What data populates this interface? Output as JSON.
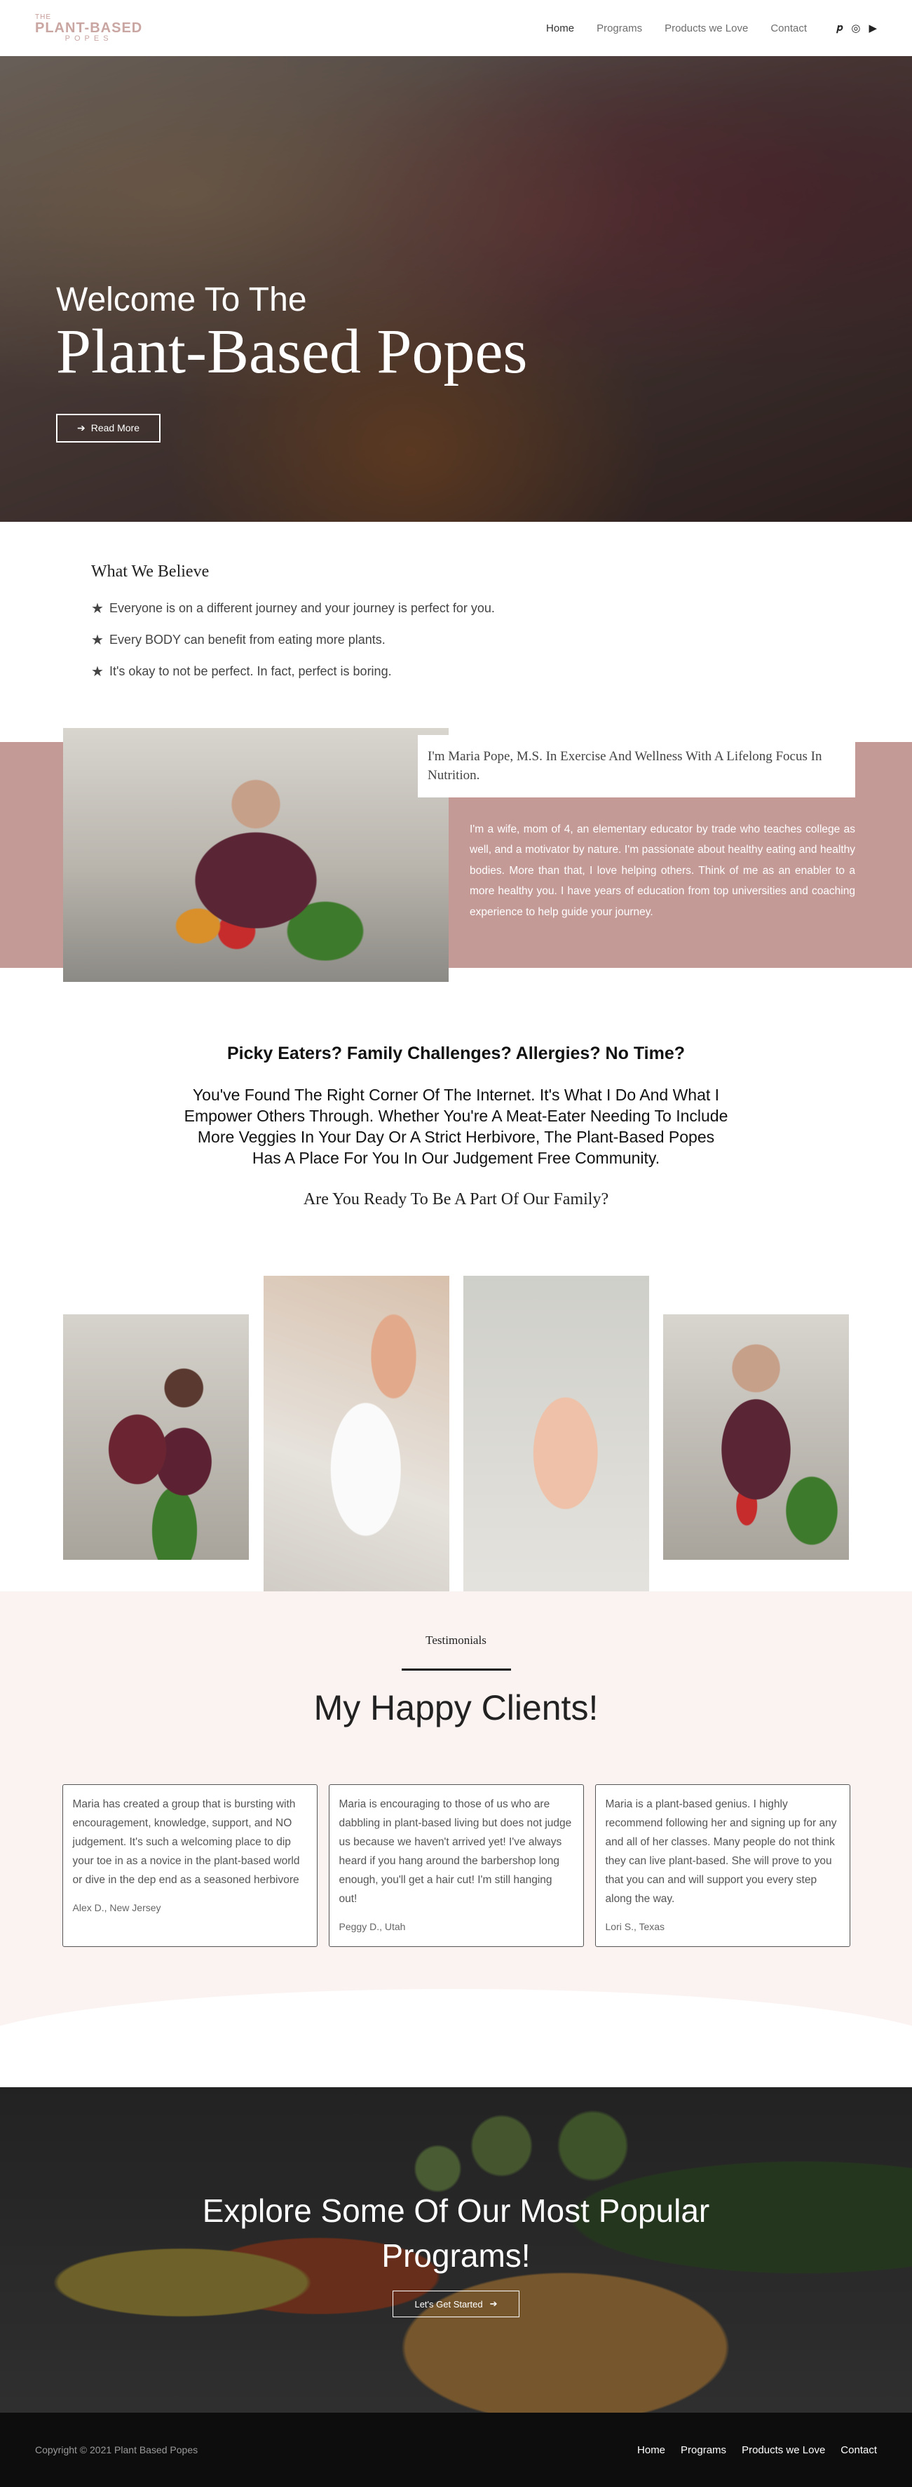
{
  "header": {
    "logo": {
      "the": "THE",
      "main": "PLANT-BASED",
      "sub": "POPES"
    },
    "nav": [
      "Home",
      "Programs",
      "Products we Love",
      "Contact"
    ],
    "social": [
      {
        "icon": "pinterest-icon",
        "glyph": "𝒑"
      },
      {
        "icon": "instagram-icon",
        "glyph": "◎"
      },
      {
        "icon": "youtube-icon",
        "glyph": "▶"
      }
    ]
  },
  "hero": {
    "subtitle": "Welcome To The",
    "title": "Plant-Based Popes",
    "button": "Read More"
  },
  "beliefs": {
    "heading": "What We Believe",
    "items": [
      "Everyone is on a different journey and your journey is perfect for you.",
      "Every BODY can benefit from eating more plants.",
      "It's okay to not be perfect. In fact, perfect is boring."
    ]
  },
  "about": {
    "card": "I'm Maria Pope, M.S. In Exercise And Wellness With A Lifelong Focus In Nutrition.",
    "text": "I'm a wife, mom of 4, an elementary educator by trade who teaches college as well, and a motivator by nature. I'm passionate about healthy eating and healthy bodies. More than that, I love helping others. Think of me as an enabler to a more healthy you. I have years of education from top universities and coaching experience to help guide your journey."
  },
  "intro": {
    "heading": "Picky Eaters? Family Challenges? Allergies? No Time?",
    "body": "You've Found The Right Corner Of The Internet. It's What I Do And What I Empower Others Through. Whether You're A Meat-Eater Needing To Include More Veggies In Your Day Or A Strict Herbivore, The Plant-Based Popes Has A Place For You In Our Judgement Free Community.",
    "question": "Are You Ready To Be A Part Of Our Family?"
  },
  "testimonials": {
    "eyebrow": "Testimonials",
    "title": "My Happy Clients!",
    "items": [
      {
        "text": "Maria has created a group that is bursting with encouragement, knowledge, support, and NO judgement. It's such a welcoming place to dip your toe in as a novice in the plant-based world or dive in the dep end as a seasoned herbivore",
        "author": "Alex D., New Jersey"
      },
      {
        "text": "Maria is encouraging to those of us who are dabbling in plant-based living but does not judge us because we haven't arrived yet! I've always heard if you hang around the barbershop long enough, you'll get a hair cut! I'm still hanging out!",
        "author": "Peggy D., Utah"
      },
      {
        "text": "Maria is a plant-based genius. I highly recommend following her and signing up for any and all of her classes. Many people do not think they can live plant-based. She will prove to you that you can and will support you every step along the way.",
        "author": "Lori S., Texas"
      }
    ]
  },
  "cta": {
    "title": "Explore Some Of Our Most Popular Programs!",
    "button": "Let's Get Started"
  },
  "footer": {
    "copyright": "Copyright © 2021 Plant Based Popes",
    "nav": [
      "Home",
      "Programs",
      "Products we Love",
      "Contact"
    ]
  },
  "colors": {
    "accent": "#c49a97",
    "testimonial_bg": "#fbf3f1",
    "footer_bg": "#0d0d0d"
  }
}
